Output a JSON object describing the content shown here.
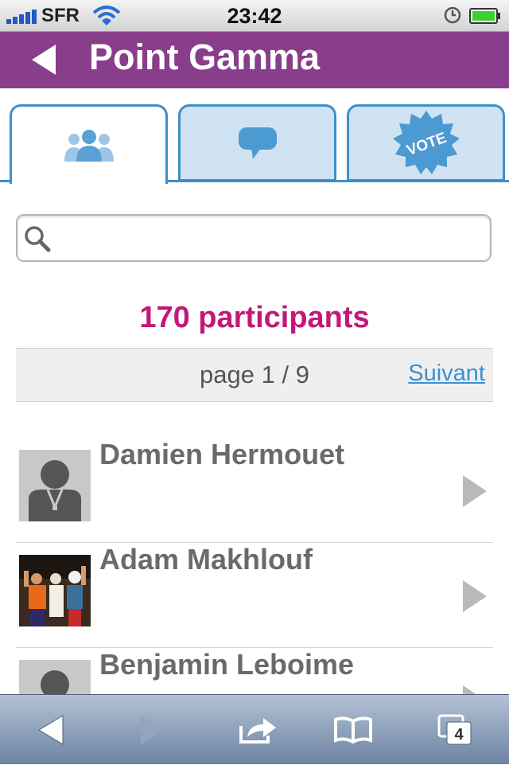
{
  "status": {
    "carrier": "SFR",
    "time": "23:42"
  },
  "header": {
    "title": "Point Gamma"
  },
  "tabs": [
    {
      "icon": "participants-icon",
      "active": true
    },
    {
      "icon": "comment-bubble-icon",
      "active": false
    },
    {
      "icon": "vote-badge-icon",
      "label": "VOTE",
      "active": false
    }
  ],
  "search": {
    "value": "",
    "placeholder": ""
  },
  "participants": {
    "count_label": "170 participants"
  },
  "pager": {
    "page_label": "page 1 / 9",
    "next_label": "Suivant"
  },
  "list": [
    {
      "name": "Damien Hermouet",
      "avatar": "default-avatar"
    },
    {
      "name": "Adam Makhlouf",
      "avatar": "photo"
    },
    {
      "name": "Benjamin Leboime",
      "avatar": "default-avatar"
    }
  ],
  "toolbar": {
    "tabs_count": "4"
  },
  "colors": {
    "header": "#883e8a",
    "accent": "#3f8fc7",
    "count": "#c4177a",
    "link": "#3c8fd0"
  }
}
